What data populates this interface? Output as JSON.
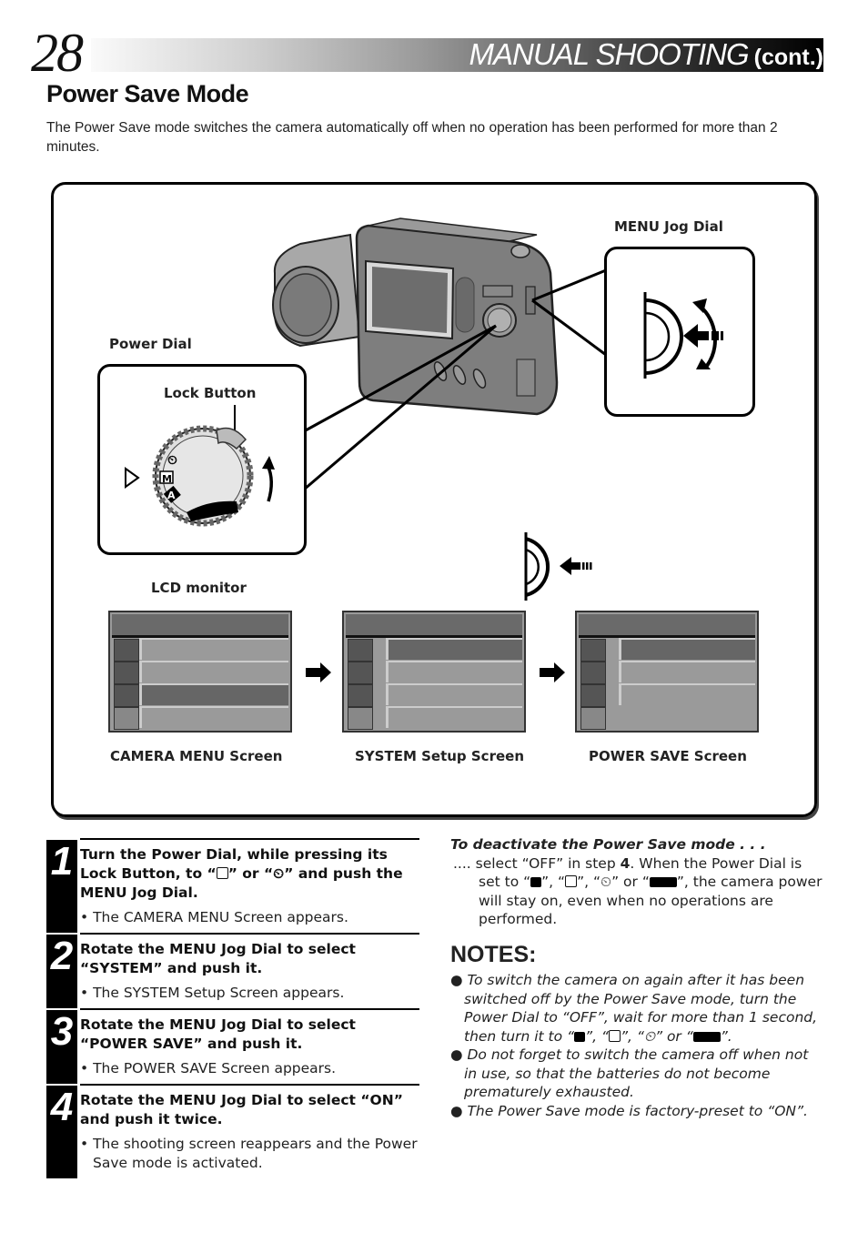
{
  "header": {
    "page_number": "28",
    "section": "MANUAL SHOOTING",
    "continued": "(cont.)"
  },
  "title": "Power Save Mode",
  "intro": "The Power Save mode switches the camera automatically off when no operation has been performed for more than 2 minutes.",
  "illustration": {
    "labels": {
      "menu_jog_dial": "MENU Jog Dial",
      "power_dial": "Power Dial",
      "lock_button": "Lock Button",
      "lcd_monitor": "LCD monitor"
    },
    "dial_icons": [
      "self-timer",
      "M",
      "A"
    ],
    "screens": [
      {
        "caption": "CAMERA MENU Screen",
        "selected_row": 3
      },
      {
        "caption": "SYSTEM Setup Screen",
        "selected_row": 1
      },
      {
        "caption": "POWER SAVE Screen",
        "selected_row": 1
      }
    ]
  },
  "steps": [
    {
      "number": "1",
      "title_parts": [
        "Turn the Power Dial, while pressing its Lock Button, to “",
        "” or “",
        "” and push the MENU Jog Dial."
      ],
      "result": "• The CAMERA MENU Screen appears."
    },
    {
      "number": "2",
      "title": "Rotate the MENU Jog Dial to select “SYSTEM” and push it.",
      "result": "• The SYSTEM Setup Screen appears."
    },
    {
      "number": "3",
      "title": "Rotate the MENU Jog Dial to select “POWER SAVE” and push it.",
      "result": "• The POWER SAVE Screen appears."
    },
    {
      "number": "4",
      "title": "Rotate the MENU Jog Dial to select “ON” and push it twice.",
      "result": "• The shooting screen reappears and the Power Save mode is activated."
    }
  ],
  "deactivate": {
    "title": "To deactivate the Power Save mode . . .",
    "lead": ".... select “OFF” in step ",
    "step_ref": "4",
    "mid": ". When the Power Dial is set to “",
    "sep1": "”, “",
    "sep2": "”, “",
    "sep3": "” or “",
    "tail": "”, the camera power will stay on, even when no operations are performed."
  },
  "notes": {
    "title": "NOTES:",
    "items": [
      {
        "text_a": "To switch the camera on again after it has been switched off by the Power Save mode, turn the Power Dial to “OFF”, wait for more than 1 second, then turn it to “",
        "sep1": "”, “",
        "sep2": "”, “",
        "sep3": "” or “",
        "text_b": "”."
      },
      {
        "text": "Do not forget to switch the camera off when not in use, so that the batteries do not become prematurely exhausted."
      },
      {
        "text": "The Power Save mode is factory-preset to “ON”."
      }
    ]
  },
  "icons": {
    "bullet": "●",
    "self_timer": "⏲"
  }
}
